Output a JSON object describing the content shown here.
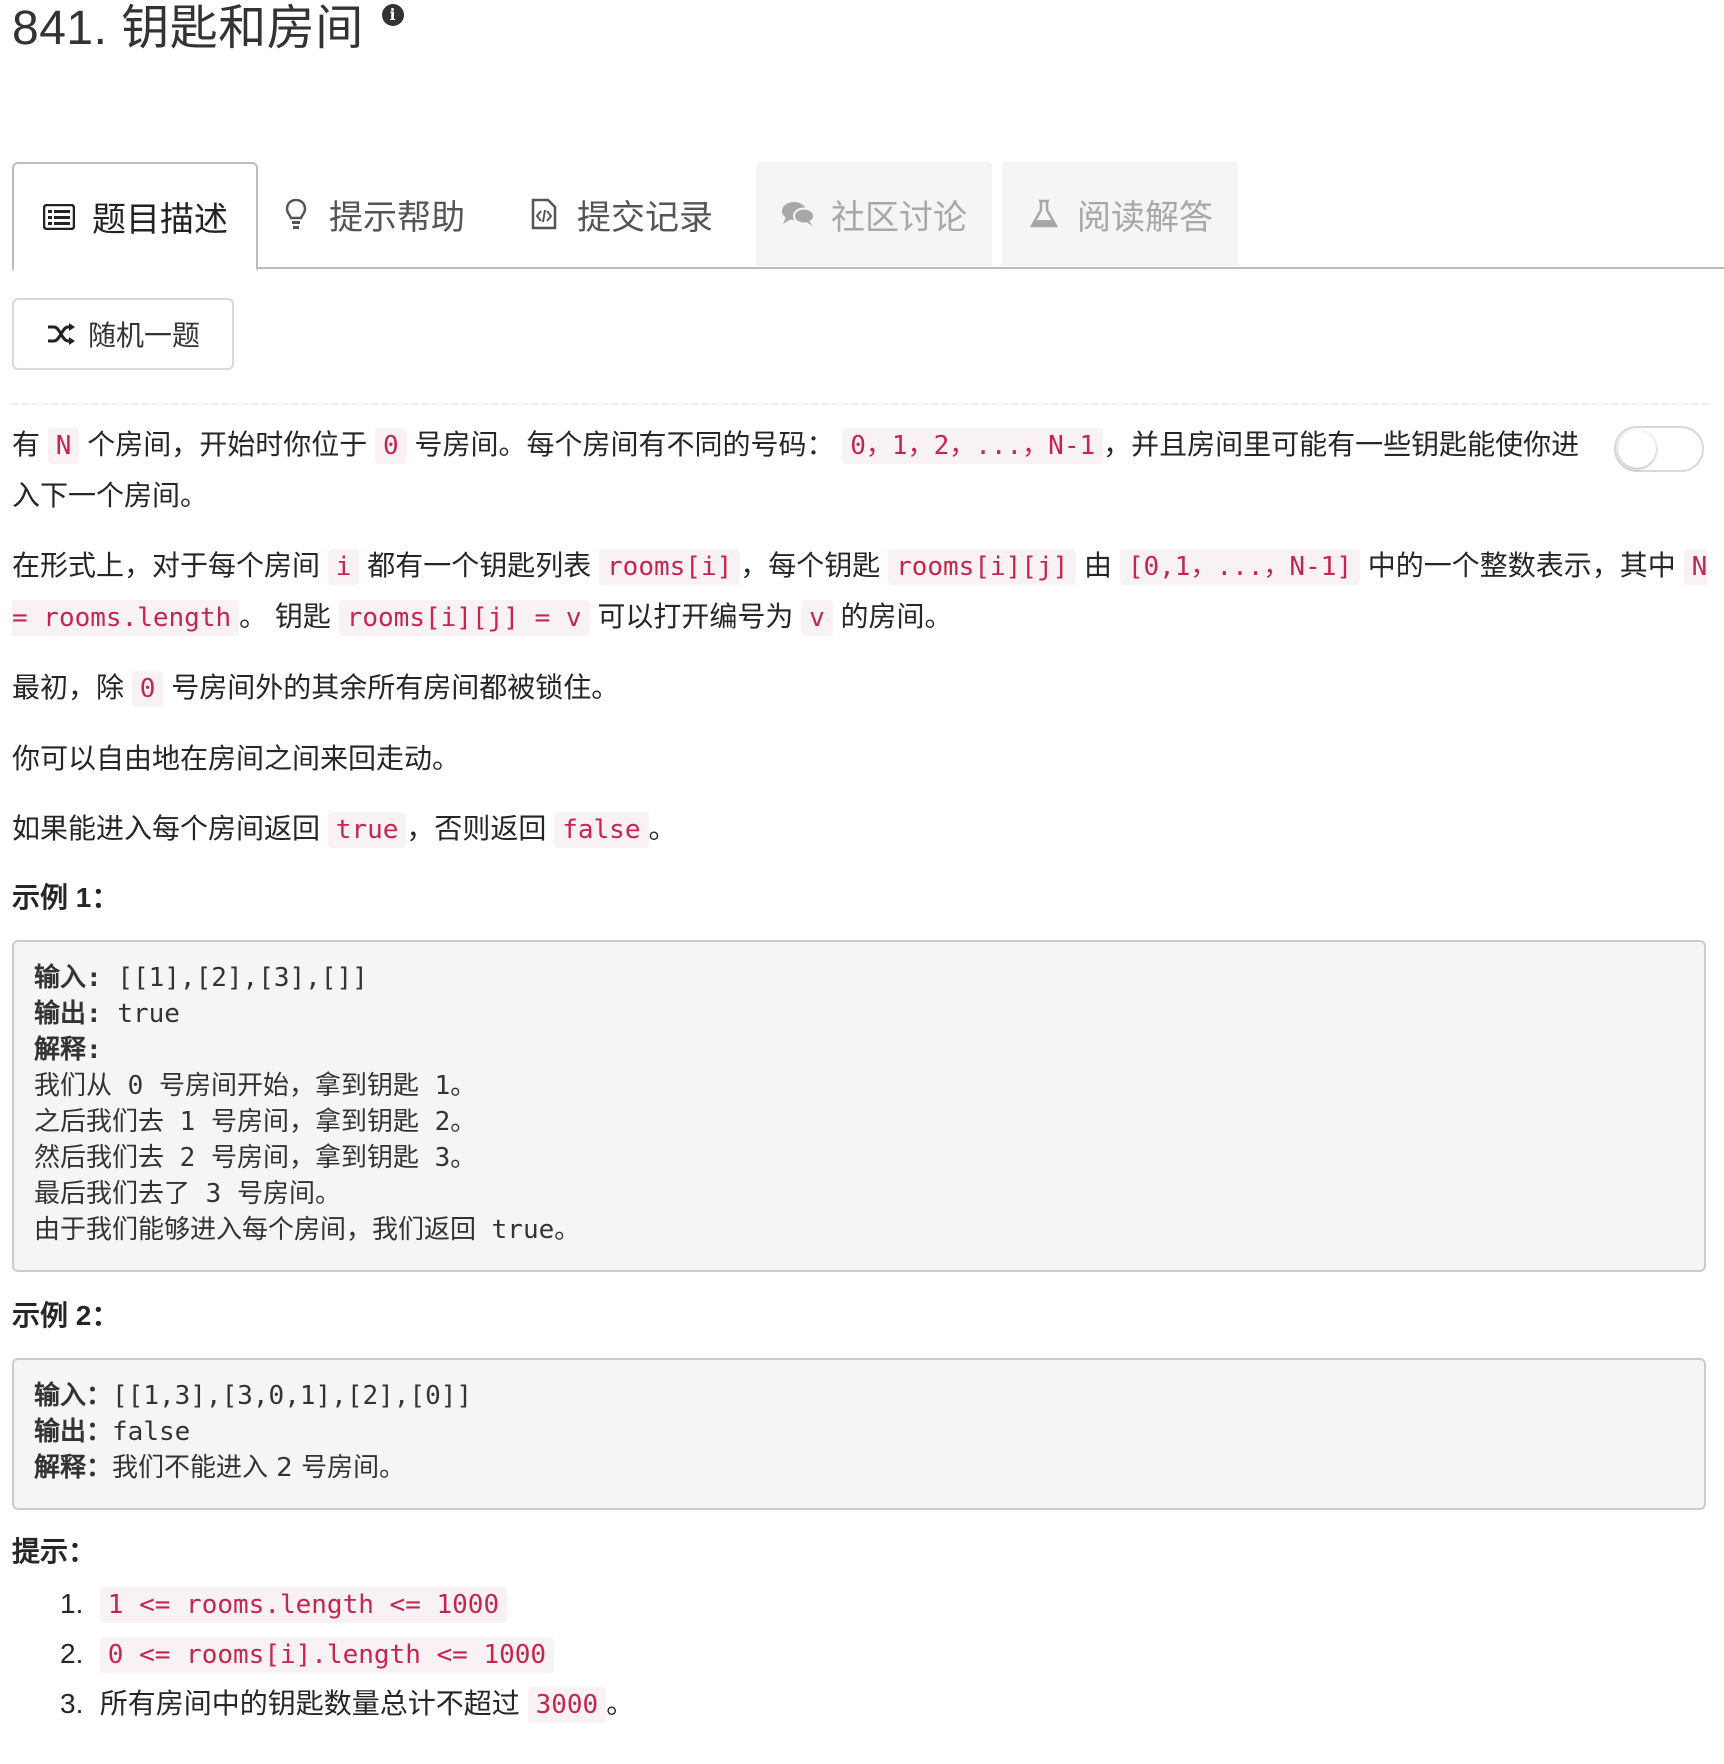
{
  "problem": {
    "title": "841. 钥匙和房间",
    "info_icon": "info-icon"
  },
  "tabs": [
    {
      "label": "题目描述",
      "icon": "list-icon",
      "state": "active"
    },
    {
      "label": "提示帮助",
      "icon": "lightbulb-icon",
      "state": "normal"
    },
    {
      "label": "提交记录",
      "icon": "code-file-icon",
      "state": "normal"
    },
    {
      "label": "社区讨论",
      "icon": "chat-icon",
      "state": "disabled"
    },
    {
      "label": "阅读解答",
      "icon": "flask-icon",
      "state": "disabled"
    }
  ],
  "random_button": {
    "label": "随机一题",
    "icon": "shuffle-icon"
  },
  "description": {
    "p1": [
      "有",
      "N",
      "个房间，开始时你位于",
      "0",
      "号房间。每个房间有不同的号码：",
      "0，1，2，...，N-1",
      "，并且房间里可能有一些钥匙能使你进入下一个房间。"
    ],
    "p2": [
      "在形式上，对于每个房间",
      "i",
      "都有一个钥匙列表",
      "rooms[i]",
      "，每个钥匙",
      "rooms[i][j]",
      "由",
      "[0,1，...，N-1]",
      "中的一个整数表示，其中",
      "N = rooms.length",
      "。 钥匙",
      "rooms[i][j] = v",
      "可以打开编号为",
      "v",
      "的房间。"
    ],
    "p3": [
      "最初，除",
      "0",
      "号房间外的其余所有房间都被锁住。"
    ],
    "p4": "你可以自由地在房间之间来回走动。",
    "p5": [
      "如果能进入每个房间返回",
      "true",
      "，否则返回",
      "false",
      "。"
    ]
  },
  "example1": {
    "label": "示例 1：",
    "input_label": "输入: ",
    "input": "[[1],[2],[3],[]]",
    "output_label": "输出: ",
    "output": "true",
    "explain_label": "解释:",
    "lines": [
      "我们从 0 号房间开始，拿到钥匙 1。",
      "之后我们去 1 号房间，拿到钥匙 2。",
      "然后我们去 2 号房间，拿到钥匙 3。",
      "最后我们去了 3 号房间。",
      "由于我们能够进入每个房间，我们返回 true。"
    ]
  },
  "example2": {
    "label": "示例 2：",
    "input_label": "输入：",
    "input": "[[1,3],[3,0,1],[2],[0]]",
    "output_label": "输出：",
    "output": "false",
    "explain_label": "解释：",
    "explain": "我们不能进入 2 号房间。"
  },
  "hints": {
    "label": "提示：",
    "items": [
      {
        "num": "1.",
        "code": "1 <= rooms.length <= 1000"
      },
      {
        "num": "2.",
        "code": "0 <= rooms[i].length <= 1000"
      },
      {
        "num": "3.",
        "text": "所有房间中的钥匙数量总计不超过",
        "code": "3000",
        "tail": "。"
      }
    ]
  },
  "toggle": {
    "state": "off"
  }
}
